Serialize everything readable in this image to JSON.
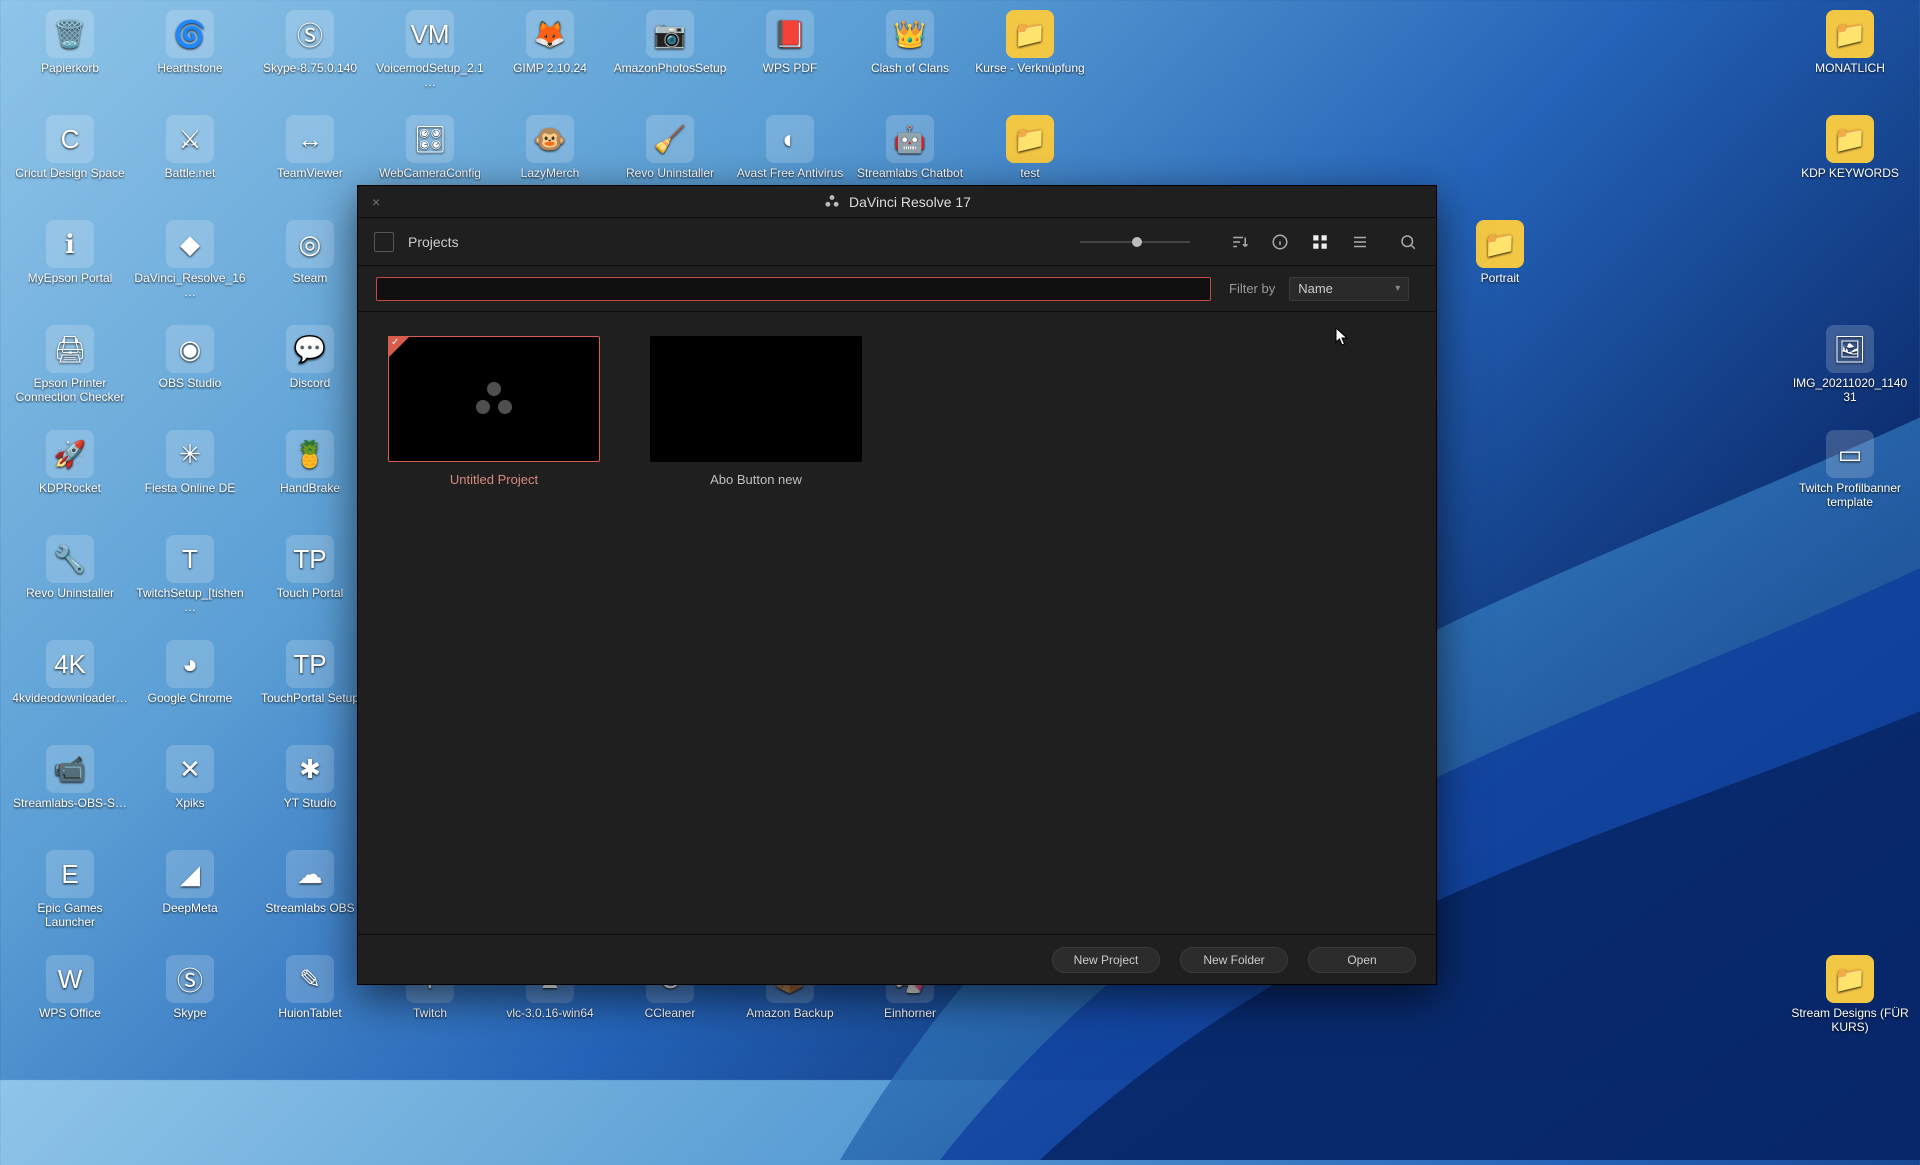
{
  "desktop_left": [
    {
      "label": "Papierkorb",
      "glyph": "🗑️"
    },
    {
      "label": "Hearthstone",
      "glyph": "🌀"
    },
    {
      "label": "Skype-8.75.0.140",
      "glyph": "Ⓢ"
    },
    {
      "label": "VoicemodSetup_2.1…",
      "glyph": "VM"
    },
    {
      "label": "GIMP 2.10.24",
      "glyph": "🦊"
    },
    {
      "label": "AmazonPhotosSetup",
      "glyph": "📷"
    },
    {
      "label": "WPS PDF",
      "glyph": "📕"
    },
    {
      "label": "Clash of Clans",
      "glyph": "👑"
    },
    {
      "label": "Kurse - Verknüpfung",
      "glyph": "📁",
      "folder": true
    },
    {
      "label": "Cricut Design Space",
      "glyph": "C"
    },
    {
      "label": "Battle.net",
      "glyph": "⚔"
    },
    {
      "label": "TeamViewer",
      "glyph": "↔"
    },
    {
      "label": "WebCameraConfig",
      "glyph": "🎛"
    },
    {
      "label": "LazyMerch",
      "glyph": "🐵"
    },
    {
      "label": "Revo Uninstaller",
      "glyph": "🧹"
    },
    {
      "label": "Avast Free Antivirus",
      "glyph": "◐"
    },
    {
      "label": "Streamlabs Chatbot",
      "glyph": "🤖"
    },
    {
      "label": "test",
      "glyph": "📁",
      "folder": true
    },
    {
      "label": "MyEpson Portal",
      "glyph": "ℹ"
    },
    {
      "label": "DaVinci_Resolve_16…",
      "glyph": "◆"
    },
    {
      "label": "Steam",
      "glyph": "◎"
    },
    {
      "label": "",
      "glyph": "",
      "blank": true
    },
    {
      "label": "",
      "glyph": "",
      "blank": true
    },
    {
      "label": "",
      "glyph": "",
      "blank": true
    },
    {
      "label": "",
      "glyph": "",
      "blank": true
    },
    {
      "label": "",
      "glyph": "",
      "blank": true
    },
    {
      "label": "",
      "glyph": "",
      "blank": true
    },
    {
      "label": "Epson Printer Connection Checker",
      "glyph": "🖨"
    },
    {
      "label": "OBS Studio",
      "glyph": "◉"
    },
    {
      "label": "Discord",
      "glyph": "💬"
    },
    {
      "label": "",
      "glyph": "",
      "blank": true
    },
    {
      "label": "",
      "glyph": "",
      "blank": true
    },
    {
      "label": "",
      "glyph": "",
      "blank": true
    },
    {
      "label": "",
      "glyph": "",
      "blank": true
    },
    {
      "label": "",
      "glyph": "",
      "blank": true
    },
    {
      "label": "",
      "glyph": "",
      "blank": true
    },
    {
      "label": "KDPRocket",
      "glyph": "🚀"
    },
    {
      "label": "Fiesta Online DE",
      "glyph": "✳"
    },
    {
      "label": "HandBrake",
      "glyph": "🍍"
    },
    {
      "label": "",
      "glyph": "",
      "blank": true
    },
    {
      "label": "",
      "glyph": "",
      "blank": true
    },
    {
      "label": "",
      "glyph": "",
      "blank": true
    },
    {
      "label": "",
      "glyph": "",
      "blank": true
    },
    {
      "label": "",
      "glyph": "",
      "blank": true
    },
    {
      "label": "",
      "glyph": "",
      "blank": true
    },
    {
      "label": "Revo Uninstaller",
      "glyph": "🔧"
    },
    {
      "label": "TwitchSetup_[tishen…",
      "glyph": "T"
    },
    {
      "label": "Touch Portal",
      "glyph": "TP"
    },
    {
      "label": "",
      "glyph": "",
      "blank": true
    },
    {
      "label": "",
      "glyph": "",
      "blank": true
    },
    {
      "label": "",
      "glyph": "",
      "blank": true
    },
    {
      "label": "",
      "glyph": "",
      "blank": true
    },
    {
      "label": "",
      "glyph": "",
      "blank": true
    },
    {
      "label": "",
      "glyph": "",
      "blank": true
    },
    {
      "label": "4kvideodownloader…",
      "glyph": "4K"
    },
    {
      "label": "Google Chrome",
      "glyph": "◕"
    },
    {
      "label": "TouchPortal Setup",
      "glyph": "TP"
    },
    {
      "label": "",
      "glyph": "",
      "blank": true
    },
    {
      "label": "",
      "glyph": "",
      "blank": true
    },
    {
      "label": "",
      "glyph": "",
      "blank": true
    },
    {
      "label": "",
      "glyph": "",
      "blank": true
    },
    {
      "label": "",
      "glyph": "",
      "blank": true
    },
    {
      "label": "",
      "glyph": "",
      "blank": true
    },
    {
      "label": "Streamlabs-OBS-S…",
      "glyph": "📹"
    },
    {
      "label": "Xpiks",
      "glyph": "✕"
    },
    {
      "label": "YT Studio",
      "glyph": "✱"
    },
    {
      "label": "",
      "glyph": "",
      "blank": true
    },
    {
      "label": "",
      "glyph": "",
      "blank": true
    },
    {
      "label": "",
      "glyph": "",
      "blank": true
    },
    {
      "label": "",
      "glyph": "",
      "blank": true
    },
    {
      "label": "",
      "glyph": "",
      "blank": true
    },
    {
      "label": "",
      "glyph": "",
      "blank": true
    },
    {
      "label": "Epic Games Launcher",
      "glyph": "E"
    },
    {
      "label": "DeepMeta",
      "glyph": "◢"
    },
    {
      "label": "Streamlabs OBS",
      "glyph": "☁"
    },
    {
      "label": "",
      "glyph": "",
      "blank": true
    },
    {
      "label": "",
      "glyph": "",
      "blank": true
    },
    {
      "label": "",
      "glyph": "",
      "blank": true
    },
    {
      "label": "",
      "glyph": "",
      "blank": true
    },
    {
      "label": "",
      "glyph": "",
      "blank": true
    },
    {
      "label": "",
      "glyph": "",
      "blank": true
    },
    {
      "label": "WPS Office",
      "glyph": "W"
    },
    {
      "label": "Skype",
      "glyph": "Ⓢ"
    },
    {
      "label": "HuionTablet",
      "glyph": "✎"
    },
    {
      "label": "Twitch",
      "glyph": "T"
    },
    {
      "label": "vlc-3.0.16-win64",
      "glyph": "▲"
    },
    {
      "label": "CCleaner",
      "glyph": "C"
    },
    {
      "label": "Amazon Backup",
      "glyph": "📦"
    },
    {
      "label": "Einhorner",
      "glyph": "🦄"
    },
    {
      "label": "",
      "glyph": "",
      "blank": true
    }
  ],
  "desktop_right": [
    {
      "label": "MONATLICH",
      "glyph": "📁",
      "folder": true
    },
    {
      "label": "KDP KEYWORDS",
      "glyph": "📁",
      "folder": true
    },
    {
      "label": "Portrait",
      "glyph": "📁",
      "folder": true,
      "shift": "-350px"
    },
    {
      "label": "IMG_20211020_114031",
      "glyph": "🖼"
    },
    {
      "label": "Twitch Profilbanner template",
      "glyph": "▭"
    },
    {
      "label": "",
      "glyph": "",
      "blank": true
    },
    {
      "label": "",
      "glyph": "",
      "blank": true
    },
    {
      "label": "",
      "glyph": "",
      "blank": true
    },
    {
      "label": "",
      "glyph": "",
      "blank": true
    },
    {
      "label": "Stream Designs (FÜR KURS)",
      "glyph": "📁",
      "folder": true
    }
  ],
  "app": {
    "title": "DaVinci Resolve 17",
    "breadcrumb": "Projects",
    "filter_label": "Filter by",
    "filter_selected": "Name",
    "search_value": "",
    "projects": [
      {
        "name": "Untitled Project",
        "selected": true,
        "placeholder": true
      },
      {
        "name": "Abo Button new",
        "selected": false,
        "placeholder": false
      }
    ],
    "buttons": {
      "new_project": "New Project",
      "new_folder": "New Folder",
      "open": "Open"
    }
  }
}
